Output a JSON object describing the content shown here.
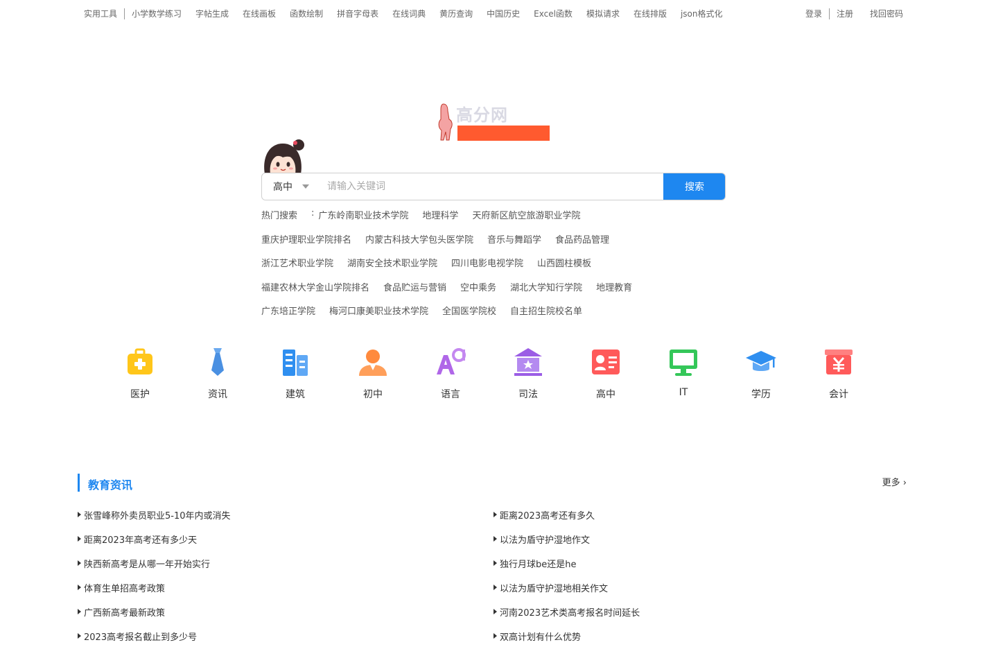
{
  "topbar": {
    "tools": [
      "实用工具",
      "小学数学练习",
      "字帖生成",
      "在线画板",
      "函数绘制",
      "拼音字母表",
      "在线词典",
      "黄历查询",
      "中国历史",
      "Excel函数",
      "模拟请求",
      "在线排版",
      "json格式化"
    ],
    "login": "登录",
    "register": "注册",
    "recover": "找回密码"
  },
  "logo": {
    "text": "高分网"
  },
  "search": {
    "category": "高中",
    "placeholder": "请输入关键词",
    "button": "搜索"
  },
  "hot": {
    "label": "热门搜索",
    "colon": ":",
    "rows": [
      [
        "广东岭南职业技术学院",
        "地理科学",
        "天府新区航空旅游职业学院"
      ],
      [
        "重庆护理职业学院排名",
        "内蒙古科技大学包头医学院",
        "音乐与舞蹈学",
        "食品药品管理"
      ],
      [
        "浙江艺术职业学院",
        "湖南安全技术职业学院",
        "四川电影电视学院",
        "山西圆柱模板"
      ],
      [
        "福建农林大学金山学院排名",
        "食品贮运与营销",
        "空中乘务",
        "湖北大学知行学院",
        "地理教育"
      ],
      [
        "广东培正学院",
        "梅河口康美职业技术学院",
        "全国医学院校",
        "自主招生院校名单"
      ]
    ]
  },
  "categories": [
    {
      "label": "医护",
      "icon": "medical-kit-icon",
      "color": "#ffc61a"
    },
    {
      "label": "资讯",
      "icon": "tie-icon",
      "color": "#4a90e2"
    },
    {
      "label": "建筑",
      "icon": "building-icon",
      "color": "#2f8ff0"
    },
    {
      "label": "初中",
      "icon": "student-icon",
      "color": "#ff8a3d"
    },
    {
      "label": "语言",
      "icon": "language-icon",
      "color": "#b067e8"
    },
    {
      "label": "司法",
      "icon": "court-icon",
      "color": "#9b5de5"
    },
    {
      "label": "高中",
      "icon": "id-card-icon",
      "color": "#ff5a5a"
    },
    {
      "label": "IT",
      "icon": "monitor-icon",
      "color": "#34c759"
    },
    {
      "label": "学历",
      "icon": "grad-cap-icon",
      "color": "#2f8ff0"
    },
    {
      "label": "会计",
      "icon": "yuan-icon",
      "color": "#ff5a5a"
    }
  ],
  "news": {
    "title": "教育资讯",
    "more": "更多",
    "left": [
      "张雪峰称外卖员职业5-10年内或消失",
      "距离2023年高考还有多少天",
      "陕西新高考是从哪一年开始实行",
      "体育生单招高考政策",
      "广西新高考最新政策",
      "2023高考报名截止到多少号"
    ],
    "right": [
      "距离2023高考还有多久",
      "以法为盾守护湿地作文",
      "独行月球be还是he",
      "以法为盾守护湿地相关作文",
      "河南2023艺术类高考报名时间延长",
      "双高计划有什么优势"
    ]
  }
}
